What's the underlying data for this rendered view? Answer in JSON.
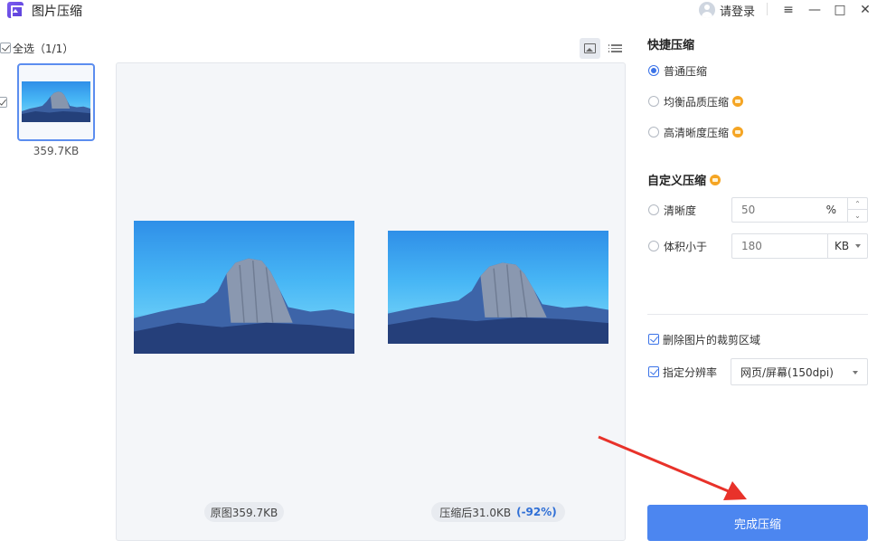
{
  "app": {
    "title": "图片压缩",
    "logo_icon": "image-compress-logo-icon"
  },
  "titlebar": {
    "login_label": "请登录",
    "menu_icon": "≡",
    "minimize_icon": "—",
    "maximize_icon": "□",
    "close_icon": "✕"
  },
  "sidebar": {
    "select_all_label": "全选（1/1）",
    "select_all_checked": true,
    "items": [
      {
        "size": "359.7KB",
        "checked": true
      }
    ]
  },
  "preview": {
    "original_label": "原图359.7KB",
    "compressed_label": "压缩后31.0KB",
    "compressed_percent": "(-92%)"
  },
  "quick": {
    "title": "快捷压缩",
    "options": [
      {
        "label": "普通压缩",
        "selected": true,
        "vip": false
      },
      {
        "label": "均衡品质压缩",
        "selected": false,
        "vip": true
      },
      {
        "label": "高清晰度压缩",
        "selected": false,
        "vip": true
      }
    ]
  },
  "custom": {
    "title": "自定义压缩",
    "clarity": {
      "label": "清晰度",
      "placeholder": "50",
      "unit": "%"
    },
    "size_limit": {
      "label": "体积小于",
      "placeholder": "180",
      "unit": "KB"
    }
  },
  "options": {
    "remove_crop_label": "删除图片的裁剪区域",
    "remove_crop_checked": true,
    "resolution_label": "指定分辨率",
    "resolution_checked": true,
    "resolution_value": "网页/屏幕(150dpi)"
  },
  "finish_button": "完成压缩",
  "colors": {
    "accent": "#4c86f0",
    "vip": "#f5a524",
    "arrow": "#e8322a"
  }
}
